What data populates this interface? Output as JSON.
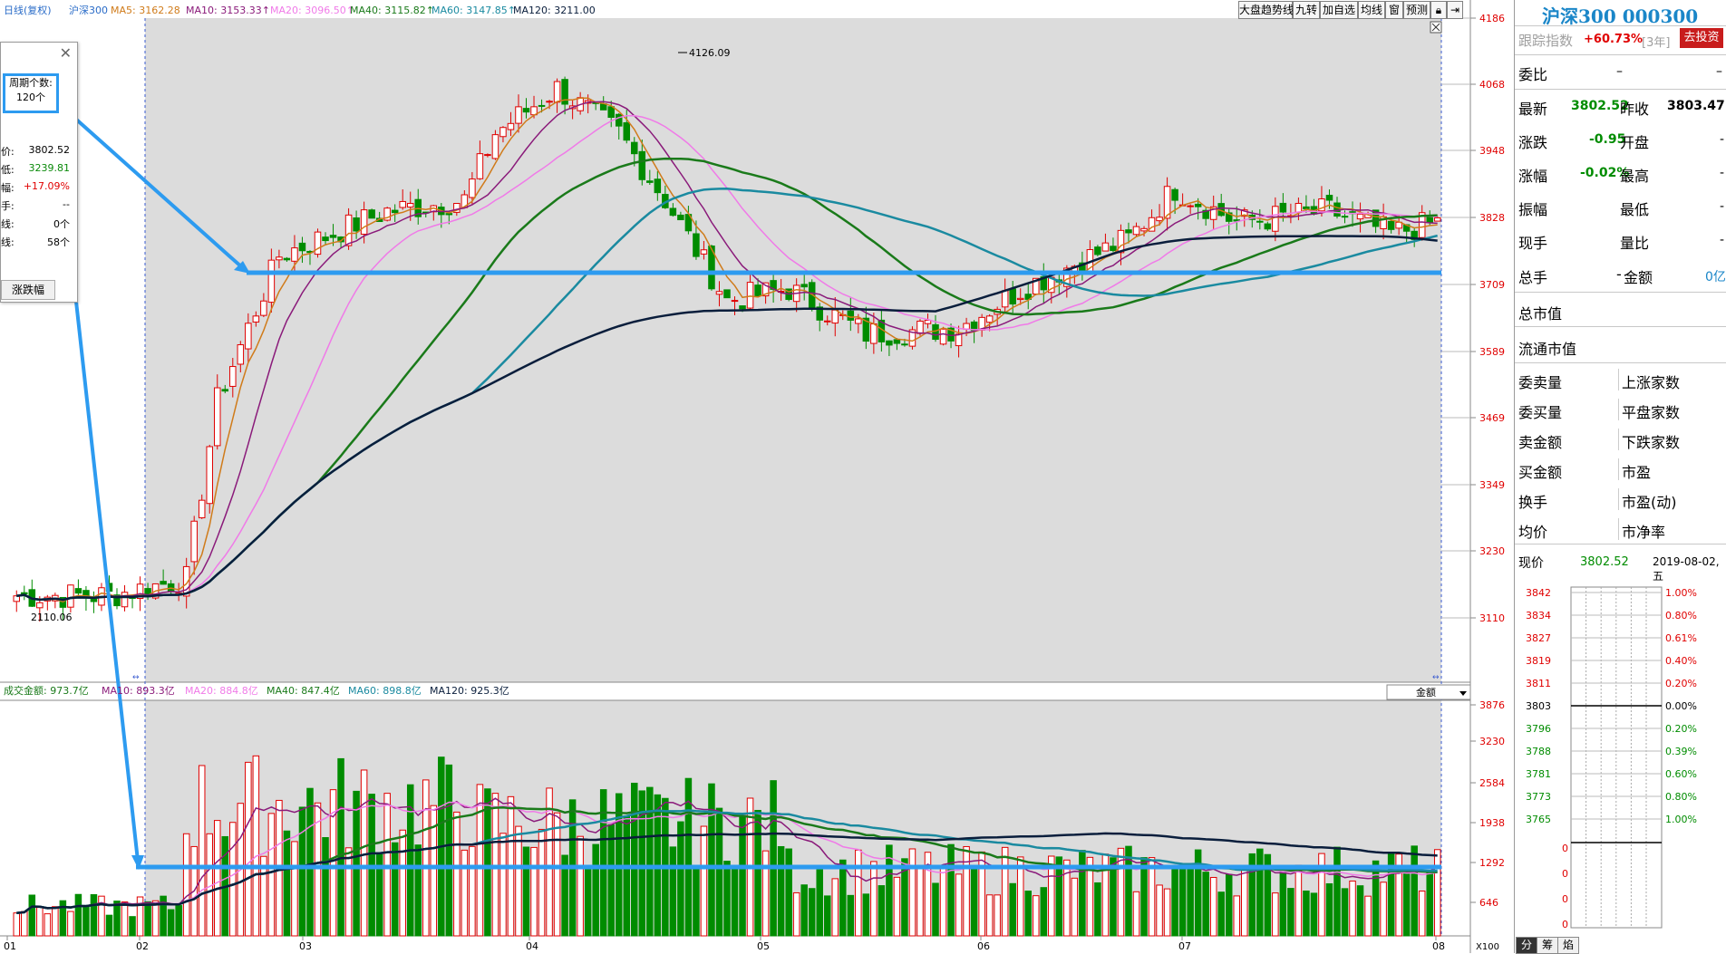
{
  "main_info": {
    "period": "日线(复权)",
    "index": "沪深300",
    "ma5": "MA5: 3162.28",
    "ma10": "MA10: 3153.33↑",
    "ma20": "MA20: 3096.50↑",
    "ma40": "MA40: 3115.82↑",
    "ma60": "MA60: 3147.85↑",
    "ma120": "MA120: 3211.00"
  },
  "toolbar": {
    "trend_label": "大盘趋势线",
    "nine_label": "九转",
    "add_label": "加自选",
    "ma_label": "均线",
    "window_label": "窗",
    "predict_label": "预测"
  },
  "price_axis": [
    "4186",
    "4068",
    "3948",
    "3828",
    "3709",
    "3589",
    "3469",
    "3349",
    "3230",
    "3110"
  ],
  "high_label": "4126.09",
  "low_label": "2110.06",
  "vol_info": {
    "name": "成交金额: 973.7亿",
    "ma10": "MA10: 893.3亿",
    "ma20": "MA20: 884.8亿",
    "ma40": "MA40: 847.4亿",
    "ma60": "MA60: 898.8亿",
    "ma120": "MA120: 925.3亿"
  },
  "vol_axis": [
    "3876",
    "3230",
    "2584",
    "1938",
    "1292",
    "646"
  ],
  "vol_unit": "X100",
  "vol_dropdown": "金额",
  "date_axis": [
    "01",
    "02",
    "03",
    "04",
    "05",
    "06",
    "07",
    "08"
  ],
  "popup": {
    "period_label": "周期个数:",
    "period_value": "120个",
    "rows": [
      {
        "label": "价:",
        "value": "3802.52",
        "color": "#000000"
      },
      {
        "label": "低:",
        "value": "3239.81",
        "color": "#0a8a0a"
      },
      {
        "label": "幅:",
        "value": "+17.09%",
        "color": "#e00000"
      },
      {
        "label": "手:",
        "value": "--",
        "color": "#000000"
      },
      {
        "label": "线:",
        "value": "0个",
        "color": "#000000"
      },
      {
        "label": "线:",
        "value": "58个",
        "color": "#000000"
      }
    ],
    "button_label": "涨跌幅"
  },
  "right_panel": {
    "title": "沪深300 000300",
    "track_label": "跟踪指数",
    "track_value": "+60.73%",
    "track_years": "[3年]",
    "invest_button": "去投资",
    "weibi_label": "委比",
    "weibi_value": "–",
    "weibi_value2": "–",
    "latest_label": "最新",
    "latest_value": "3802.52",
    "prev_close_label": "昨收",
    "prev_close_value": "3803.47",
    "change_label": "涨跌",
    "change_value": "-0.95",
    "open_label": "开盘",
    "change_pct_label": "涨幅",
    "change_pct_value": "-0.02%",
    "high_label": "最高",
    "amplitude_label": "振幅",
    "low_label": "最低",
    "current_hand_label": "现手",
    "vol_ratio_label": "量比",
    "total_hand_label": "总手",
    "amount_label": "金额",
    "amount_value": "0亿",
    "total_mv_label": "总市值",
    "float_mv_label": "流通市值",
    "grid_left": [
      "委卖量",
      "委买量",
      "卖金额",
      "买金额",
      "换手",
      "均价"
    ],
    "grid_right": [
      "上涨家数",
      "平盘家数",
      "下跌家数",
      "市盈",
      "市盈(动)",
      "市净率"
    ],
    "now_label": "现价",
    "now_value": "3802.52",
    "now_date": "2019-08-02,五",
    "intraday_prices": [
      "3842",
      "3834",
      "3827",
      "3819",
      "3811",
      "3803",
      "3796",
      "3788",
      "3781",
      "3773",
      "3765"
    ],
    "intraday_pcts": [
      "1.00%",
      "0.80%",
      "0.61%",
      "0.40%",
      "0.20%",
      "0.00%",
      "0.20%",
      "0.39%",
      "0.60%",
      "0.80%",
      "1.00%"
    ],
    "intraday_vol_ticks": [
      "0",
      "0",
      "0",
      "0"
    ],
    "tabs": [
      "分",
      "筹",
      "焰"
    ]
  },
  "colors": {
    "up": "#e00000",
    "down": "#008c00",
    "ma5": "#d07b1a",
    "ma10": "#8a1a7a",
    "ma20": "#f07ae8",
    "ma40": "#1a7a1a",
    "ma60": "#1a8aa0",
    "ma120": "#0a1e3c",
    "highlight": "#2d9bf0"
  }
}
